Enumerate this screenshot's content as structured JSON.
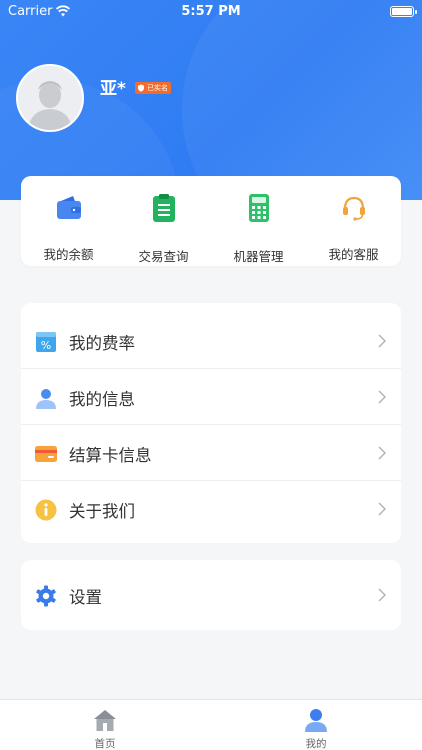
{
  "status_bar": {
    "carrier": "Carrier",
    "time": "5:57 PM"
  },
  "profile": {
    "name": "亚*",
    "verified_badge": "已实名"
  },
  "quick_actions": [
    {
      "label": "我的余额",
      "icon": "wallet-icon"
    },
    {
      "label": "交易查询",
      "icon": "clipboard-icon"
    },
    {
      "label": "机器管理",
      "icon": "calculator-icon"
    },
    {
      "label": "我的客服",
      "icon": "headset-icon"
    }
  ],
  "menu": [
    {
      "label": "我的费率",
      "icon": "rate-icon"
    },
    {
      "label": "我的信息",
      "icon": "user-icon"
    },
    {
      "label": "结算卡信息",
      "icon": "card-icon"
    },
    {
      "label": "关于我们",
      "icon": "info-icon"
    }
  ],
  "settings": {
    "label": "设置",
    "icon": "gear-icon"
  },
  "tabs": [
    {
      "label": "首页",
      "icon": "home-icon"
    },
    {
      "label": "我的",
      "icon": "profile-icon"
    }
  ],
  "colors": {
    "header_blue": "#3485f5",
    "badge_orange": "#f26c2e",
    "background": "#f5f6f8"
  }
}
